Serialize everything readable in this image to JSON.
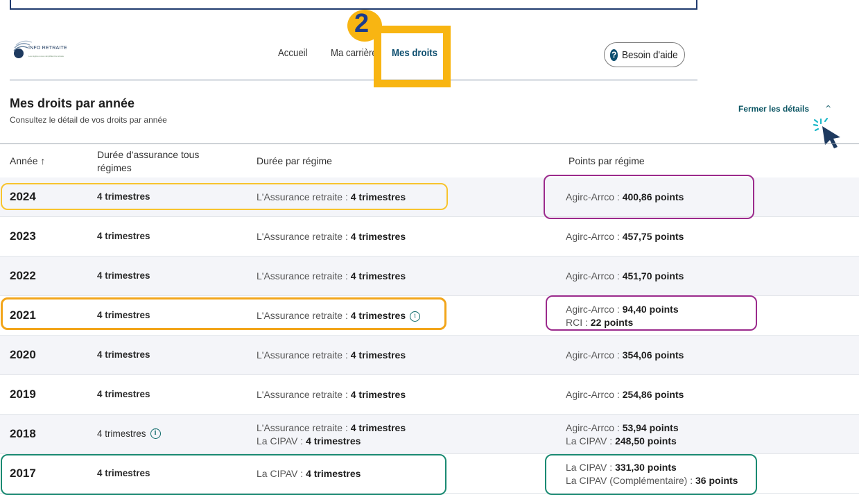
{
  "logo": {
    "text": "INFO RETRAITE",
    "tagline": "Les régimes vous simplifient la retraite"
  },
  "nav": {
    "items": [
      "Accueil",
      "Ma carrière",
      "Mes droits"
    ],
    "active": "Mes droits"
  },
  "step_badge": "2",
  "help_button": {
    "label": "Besoin d'aide",
    "icon": "question-circle-icon"
  },
  "header": {
    "title": "Mes droits par année",
    "subtitle": "Consultez le détail de vos droits par année"
  },
  "details_toggle": "Fermer les détails",
  "table": {
    "columns": [
      "Année ↑",
      "Durée d'assurance tous régimes",
      "Durée par régime",
      "Points par régime"
    ],
    "rows": [
      {
        "year": "2024",
        "duration": "4 trimestres",
        "regimes": [
          {
            "name": "L'Assurance retraite",
            "value": "4 trimestres"
          }
        ],
        "points": [
          {
            "name": "Agirc-Arrco",
            "value": "400,86 points"
          }
        ]
      },
      {
        "year": "2023",
        "duration": "4 trimestres",
        "regimes": [
          {
            "name": "L'Assurance retraite",
            "value": "4 trimestres"
          }
        ],
        "points": [
          {
            "name": "Agirc-Arrco",
            "value": "457,75 points"
          }
        ]
      },
      {
        "year": "2022",
        "duration": "4 trimestres",
        "regimes": [
          {
            "name": "L'Assurance retraite",
            "value": "4 trimestres"
          }
        ],
        "points": [
          {
            "name": "Agirc-Arrco",
            "value": "451,70 points"
          }
        ]
      },
      {
        "year": "2021",
        "duration": "4 trimestres",
        "regimes": [
          {
            "name": "L'Assurance retraite",
            "value": "4 trimestres",
            "info": true
          }
        ],
        "points": [
          {
            "name": "Agirc-Arrco",
            "value": "94,40 points"
          },
          {
            "name": "RCI",
            "value": "22 points"
          }
        ]
      },
      {
        "year": "2020",
        "duration": "4 trimestres",
        "regimes": [
          {
            "name": "L'Assurance retraite",
            "value": "4 trimestres"
          }
        ],
        "points": [
          {
            "name": "Agirc-Arrco",
            "value": "354,06 points"
          }
        ]
      },
      {
        "year": "2019",
        "duration": "4 trimestres",
        "regimes": [
          {
            "name": "L'Assurance retraite",
            "value": "4 trimestres"
          }
        ],
        "points": [
          {
            "name": "Agirc-Arrco",
            "value": "254,86 points"
          }
        ]
      },
      {
        "year": "2018",
        "duration": "4 trimestres",
        "duration_info": true,
        "regimes": [
          {
            "name": "L'Assurance retraite",
            "value": "4 trimestres"
          },
          {
            "name": "La CIPAV",
            "value": "4 trimestres"
          }
        ],
        "points": [
          {
            "name": "Agirc-Arrco",
            "value": "53,94 points"
          },
          {
            "name": "La CIPAV",
            "value": "248,50 points"
          }
        ]
      },
      {
        "year": "2017",
        "duration": "4 trimestres",
        "regimes": [
          {
            "name": "La CIPAV",
            "value": "4 trimestres"
          }
        ],
        "points": [
          {
            "name": "La CIPAV",
            "value": "331,30 points"
          },
          {
            "name": "La CIPAV (Complémentaire)",
            "value": "36 points"
          }
        ]
      }
    ]
  },
  "colors": {
    "highlight_yellow": "#f8c42e",
    "highlight_orange": "#f2a51a",
    "highlight_purple": "#9b2a8c",
    "highlight_green": "#1a8a72",
    "brand_teal": "#0b4d6e"
  }
}
